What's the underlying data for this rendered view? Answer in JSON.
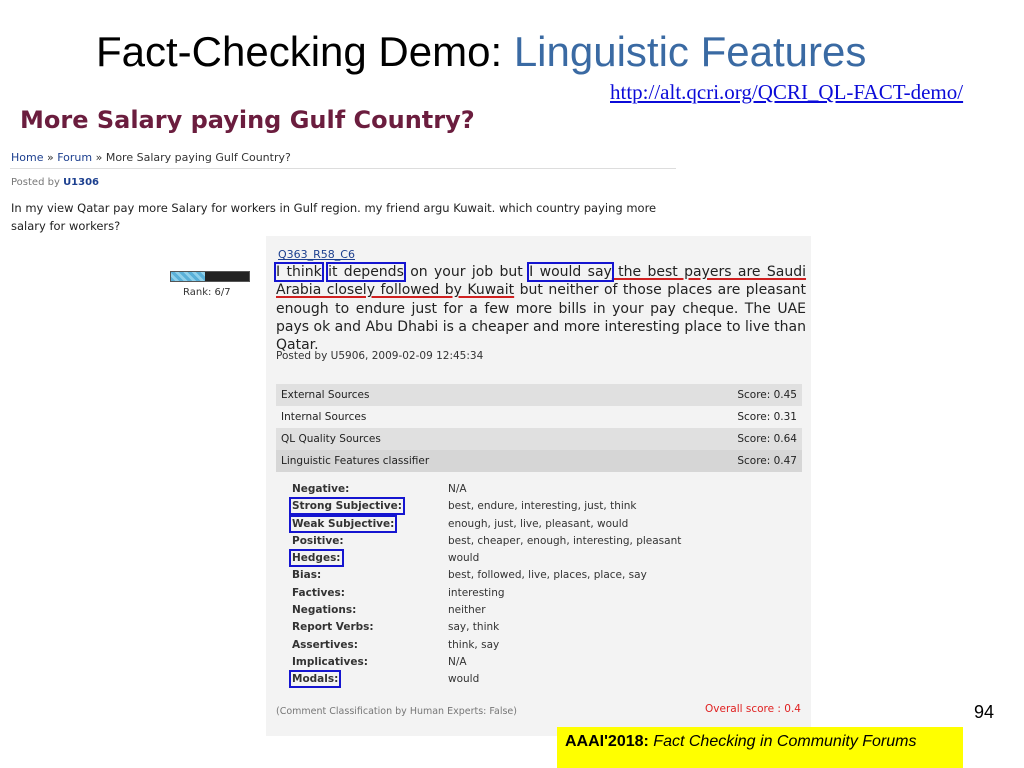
{
  "slide": {
    "title_main": "Fact-Checking Demo: ",
    "title_accent": "Linguistic Features",
    "url": "http://alt.qcri.org/QCRI_QL-FACT-demo/",
    "page_number": "94",
    "citation_bold": "AAAI'2018:",
    "citation_italic": "Fact Checking in Community Forums"
  },
  "forum": {
    "title": "More Salary paying Gulf Country?",
    "breadcrumb": [
      "Home",
      "Forum",
      "More Salary paying Gulf Country?"
    ],
    "breadcrumb_sep": " » ",
    "posted_by_label": "Posted by",
    "posted_by_user": "U1306",
    "question": "In my view Qatar pay more Salary for workers in Gulf region. my friend argu Kuwait. which country paying more salary for workers?"
  },
  "comment": {
    "rank_label": "Rank: 6/7",
    "rank_fraction": 0.43,
    "id": "Q363_R58_C6",
    "seg1": "I think",
    "seg2": "it depends",
    "seg3": " on your job but ",
    "seg4": "I would say",
    "seg5": " the best payers are Saudi Arabia closely followed by Kuwait",
    "seg6": " but neither of those places are pleasant enough to endure just for a few more bills in your pay cheque. The UAE pays ok and Abu Dhabi is a cheaper and more interesting place to live than Qatar.",
    "meta": "Posted by U5906, 2009-02-09 12:45:34"
  },
  "scores": [
    {
      "label": "External Sources",
      "score": "Score: 0.45"
    },
    {
      "label": "Internal Sources",
      "score": "Score: 0.31"
    },
    {
      "label": "QL Quality Sources",
      "score": "Score: 0.64"
    },
    {
      "label": "Linguistic Features classifier",
      "score": "Score: 0.47"
    }
  ],
  "features": [
    {
      "name": "Negative:",
      "value": "N/A"
    },
    {
      "name": "Strong Subjective:",
      "value": "best, endure, interesting, just, think"
    },
    {
      "name": "Weak Subjective:",
      "value": "enough, just, live, pleasant, would"
    },
    {
      "name": "Positive:",
      "value": "best, cheaper, enough, interesting, pleasant"
    },
    {
      "name": "Hedges:",
      "value": "would"
    },
    {
      "name": "Bias:",
      "value": "best, followed, live, places, place, say"
    },
    {
      "name": "Factives:",
      "value": "interesting"
    },
    {
      "name": "Negations:",
      "value": "neither"
    },
    {
      "name": "Report Verbs:",
      "value": "say, think"
    },
    {
      "name": "Assertives:",
      "value": "think, say"
    },
    {
      "name": "Implicatives:",
      "value": "N/A"
    },
    {
      "name": "Modals:",
      "value": "would"
    }
  ],
  "footer": {
    "classification": "(Comment Classification by Human Experts: False)",
    "overall": "Overall score : 0.4"
  }
}
